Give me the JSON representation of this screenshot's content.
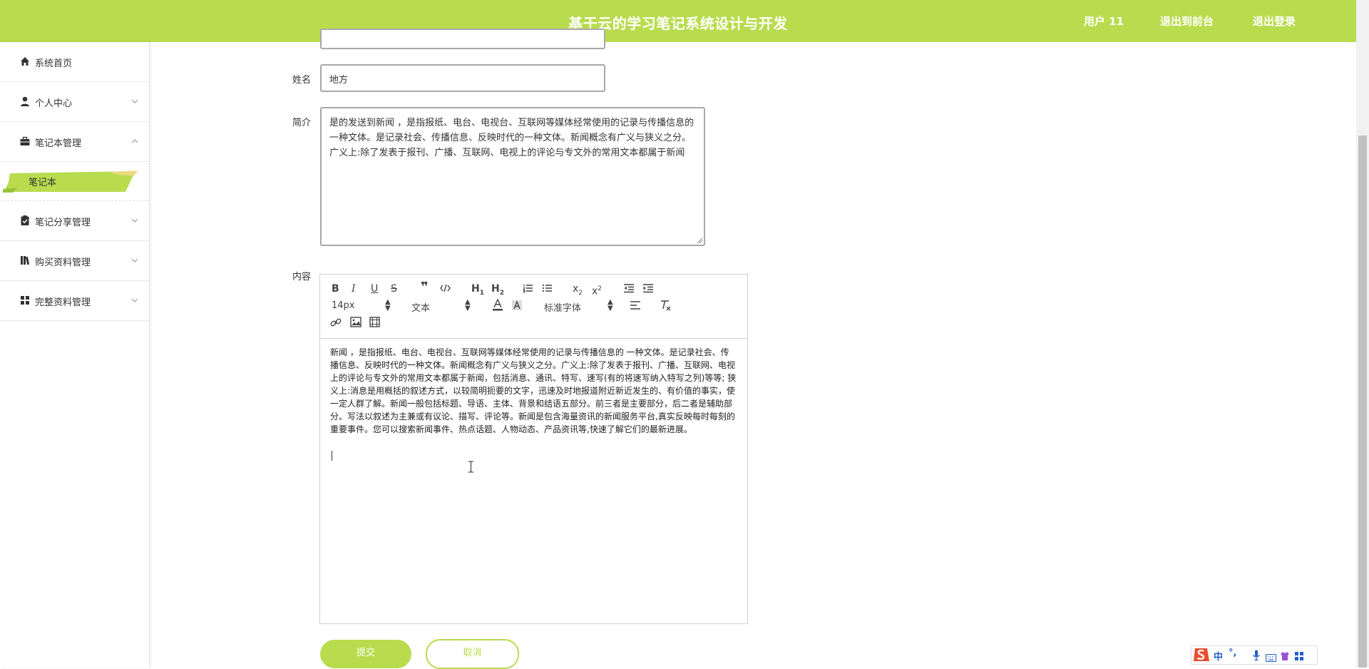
{
  "header": {
    "title": "基于云的学习笔记系统设计与开发",
    "user": "用户 11",
    "back_to_front": "退出到前台",
    "logout": "退出登录"
  },
  "sidebar": {
    "items": [
      {
        "label": "系统首页",
        "icon": "home-icon"
      },
      {
        "label": "个人中心",
        "icon": "user-icon"
      },
      {
        "label": "笔记本管理",
        "icon": "briefcase-icon"
      },
      {
        "label": "笔记分享管理",
        "icon": "clipboard-icon"
      },
      {
        "label": "购买资料管理",
        "icon": "book-icon"
      },
      {
        "label": "完整资料管理",
        "icon": "grid-icon"
      }
    ],
    "submenu_active": "笔记本"
  },
  "form": {
    "name_label": "姓名",
    "name_value": "地方",
    "intro_label": "简介",
    "intro_value": "是的发送到新闻 ，是指报纸、电台、电视台、互联网等媒体经常使用的记录与传播信息的 一种文体。是记录社会、传播信息、反映时代的一种文体。新闻概念有广义与狭义之分。广义上:除了发表于报刊、广播、互联网、电视上的评论与专文外的常用文本都属于新闻",
    "content_label": "内容",
    "content_value": "新闻 ，是指报纸、电台、电视台、互联网等媒体经常使用的记录与传播信息的 一种文体。是记录社会、传播信息、反映时代的一种文体。新闻概念有广义与狭义之分。广义上:除了发表于报刊、广播、互联网、电视上的评论与专文外的常用文本都属于新闻，包括消息、通讯、特写、速写(有的将速写纳入特写之列)等等; 狭义上:消息是用概括的叙述方式，以较简明扼要的文字，迅速及时地报道附近新近发生的、有价值的事实，使一定人群了解。新闻一般包括标题、导语、主体、背景和结语五部分。前三者是主要部分，后二者是辅助部分。写法以叙述为主兼或有议论、描写、评论等。新闻是包含海量资讯的新闻服务平台,真实反映每时每刻的重要事件。您可以搜索新闻事件、热点话题、人物动态、产品资讯等,快速了解它们的最新进展。",
    "submit_label": "提交",
    "cancel_label": "取消"
  },
  "editor_toolbar": {
    "font_size": "14px",
    "block_format": "文本",
    "font_family": "标准字体",
    "h1": "H",
    "h2": "H",
    "h1_sub": "1",
    "h2_sub": "2",
    "subscript_base": "x",
    "subscript_mark": "2",
    "superscript_base": "x",
    "superscript_mark": "2"
  },
  "ime": {
    "lang": "中"
  },
  "colors": {
    "accent": "#b8dc4e",
    "header_text": "#ffffff"
  }
}
